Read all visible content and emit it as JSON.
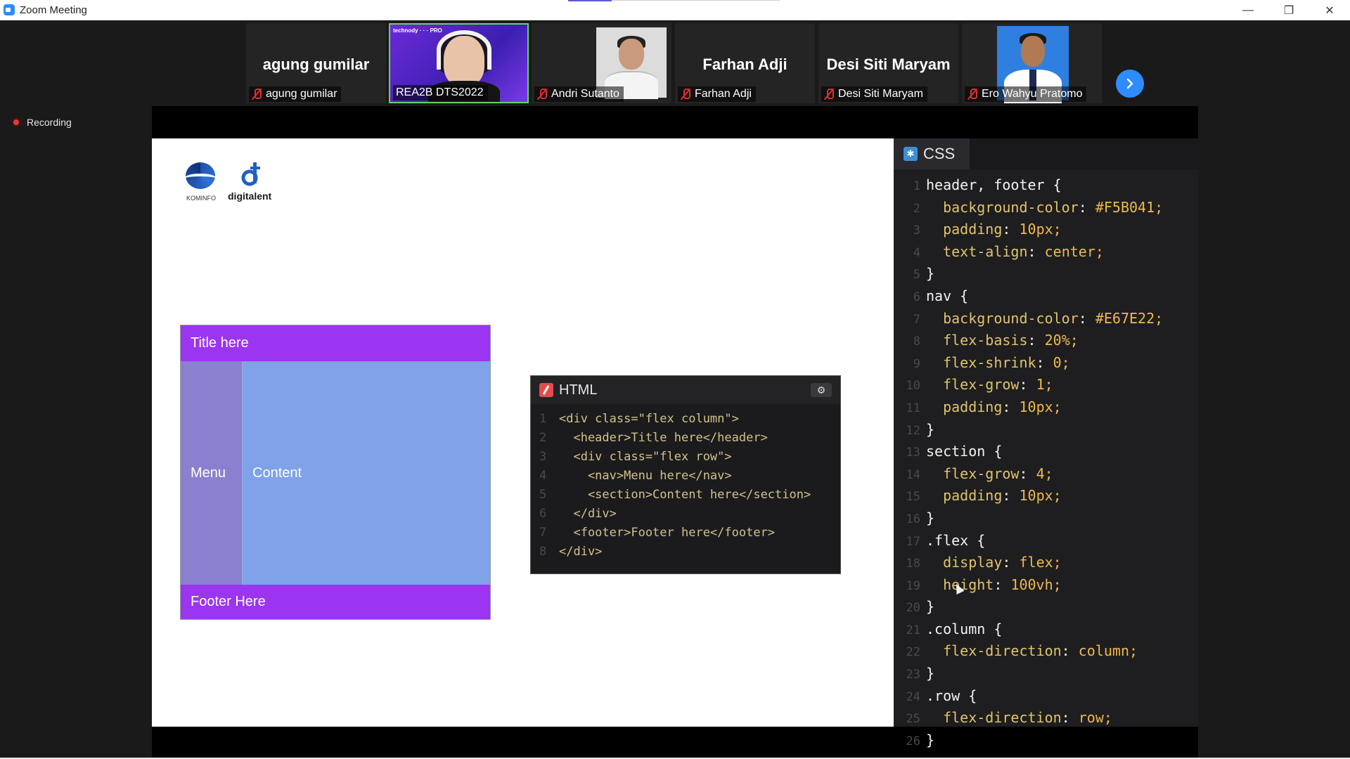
{
  "window": {
    "title": "Zoom Meeting",
    "controls": [
      "—",
      "❐",
      "✕"
    ]
  },
  "participants": [
    {
      "name": "agung gumilar",
      "display_name": "agung gumilar",
      "video": false
    },
    {
      "name": "REA2B DTS2022",
      "video": true,
      "banner": "technody · · · PRO"
    },
    {
      "name": "Andri Sutanto",
      "video": true
    },
    {
      "name": "Farhan Adji",
      "display_name": "Farhan Adji",
      "video": false
    },
    {
      "name": "Desi Siti Maryam",
      "display_name": "Desi Siti Maryam",
      "video": false
    },
    {
      "name": "Ero Wahyu Pratomo",
      "video": true
    }
  ],
  "recording": {
    "label": "Recording"
  },
  "slide": {
    "logos": {
      "kominfo": "KOMINFO",
      "digitalent": "digitalent"
    },
    "demo": {
      "header": "Title here",
      "nav": "Menu",
      "section": "Content",
      "footer": "Footer Here"
    },
    "html_panel": {
      "tab": "HTML",
      "lines": [
        {
          "n": "1",
          "text": "<div class=\"flex column\">"
        },
        {
          "n": "2",
          "text": "  <header>Title here</header>"
        },
        {
          "n": "3",
          "text": "  <div class=\"flex row\">"
        },
        {
          "n": "4",
          "text": "    <nav>Menu here</nav>"
        },
        {
          "n": "5",
          "text": "    <section>Content here</section>"
        },
        {
          "n": "6",
          "text": "  </div>"
        },
        {
          "n": "7",
          "text": "  <footer>Footer here</footer>"
        },
        {
          "n": "8",
          "text": "</div>"
        }
      ]
    },
    "css_panel": {
      "tab": "CSS",
      "lines": [
        {
          "n": "1",
          "text": "header, footer {"
        },
        {
          "n": "2",
          "text": "  background-color: #F5B041;"
        },
        {
          "n": "3",
          "text": "  padding: 10px;"
        },
        {
          "n": "4",
          "text": "  text-align: center;"
        },
        {
          "n": "5",
          "text": "}"
        },
        {
          "n": "6",
          "text": "nav {"
        },
        {
          "n": "7",
          "text": "  background-color: #E67E22;"
        },
        {
          "n": "8",
          "text": "  flex-basis: 20%;"
        },
        {
          "n": "9",
          "text": "  flex-shrink: 0;"
        },
        {
          "n": "10",
          "text": "  flex-grow: 1;"
        },
        {
          "n": "11",
          "text": "  padding: 10px;"
        },
        {
          "n": "12",
          "text": "}"
        },
        {
          "n": "13",
          "text": "section {"
        },
        {
          "n": "14",
          "text": "  flex-grow: 4;"
        },
        {
          "n": "15",
          "text": "  padding: 10px;"
        },
        {
          "n": "16",
          "text": "}"
        },
        {
          "n": "17",
          "text": ".flex {"
        },
        {
          "n": "18",
          "text": "  display: flex;"
        },
        {
          "n": "19",
          "text": "  height: 100vh;"
        },
        {
          "n": "20",
          "text": "}"
        },
        {
          "n": "21",
          "text": ".column {"
        },
        {
          "n": "22",
          "text": "  flex-direction: column;"
        },
        {
          "n": "23",
          "text": "}"
        },
        {
          "n": "24",
          "text": ".row {"
        },
        {
          "n": "25",
          "text": "  flex-direction: row;"
        },
        {
          "n": "26",
          "text": "}"
        }
      ]
    }
  },
  "colors": {
    "accent": "#2d8cff",
    "demo_header": "#9b35ef",
    "demo_nav": "#8b7fcf",
    "demo_section": "#7fa2e8",
    "recording": "#e23a3a"
  }
}
